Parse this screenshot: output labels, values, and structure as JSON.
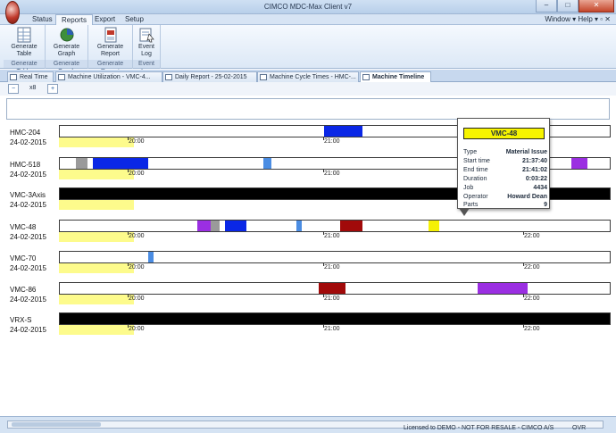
{
  "window": {
    "title": "CIMCO MDC-Max Client v7",
    "buttons": {
      "minimize": "–",
      "maximize": "□",
      "close": "✕"
    }
  },
  "menu": {
    "tabs": [
      "Status",
      "Reports",
      "Export",
      "Setup"
    ],
    "active_index": 1,
    "right": "Window ▾  Help ▾  ▫ ✕"
  },
  "ribbon": {
    "groups": [
      {
        "label": "Generate Table",
        "button": "Generate\nTable",
        "icon": "table-icon"
      },
      {
        "label": "Generate Graph",
        "button": "Generate\nGraph",
        "icon": "graph-icon"
      },
      {
        "label": "Generate Report",
        "button": "Generate\nReport",
        "icon": "report-icon"
      },
      {
        "label": "Event Log",
        "button": "Event\nLog",
        "icon": "event-log-icon"
      }
    ]
  },
  "doc_tabs": [
    "Real Time",
    "Machine Utilization - VMC-4...",
    "Daily Report - 25-02-2015",
    "Machine Cycle Times - HMC-...",
    "Machine Timeline"
  ],
  "toolbar": {
    "zoom_out_icon": "zoom-out-icon",
    "zoom_value": "x8",
    "zoom_in_icon": "zoom-in-icon"
  },
  "colors": {
    "running": "#138a13",
    "stopped": "#e4110e",
    "blue": "#0a27e6",
    "purple": "#9b2fe2",
    "maroon": "#a10a0a",
    "gray": "#9a9a9a",
    "light_blue": "#4b8de3",
    "yellow": "#f5f105",
    "offline": "#000000"
  },
  "machines": [
    {
      "name": "HMC-204",
      "date": "24-02-2015",
      "ticks": [
        "20:00",
        "21:00"
      ],
      "segments": [
        [
          "red",
          0,
          1.2
        ],
        [
          "green",
          1.2,
          4
        ],
        [
          "red",
          4,
          4.8
        ],
        [
          "green",
          4.8,
          8
        ],
        [
          "red",
          8,
          9
        ],
        [
          "green",
          9,
          14
        ],
        [
          "red",
          14,
          15
        ],
        [
          "green",
          15,
          19
        ],
        [
          "red",
          19,
          20.5
        ],
        [
          "green",
          20.5,
          26
        ],
        [
          "red",
          26,
          27
        ],
        [
          "green",
          27,
          30
        ],
        [
          "red",
          30,
          31
        ],
        [
          "green",
          31,
          35
        ],
        [
          "red",
          35,
          36
        ],
        [
          "green",
          36,
          40
        ],
        [
          "red",
          40,
          41.5
        ],
        [
          "green",
          41.5,
          44
        ],
        [
          "red",
          44,
          45
        ],
        [
          "green",
          45,
          48
        ],
        [
          "blue",
          48,
          55
        ],
        [
          "red",
          55,
          57
        ],
        [
          "green",
          57,
          60
        ],
        [
          "red",
          60,
          61
        ],
        [
          "green",
          61,
          63
        ],
        [
          "red",
          63,
          64
        ],
        [
          "green",
          64,
          67
        ],
        [
          "red",
          67,
          68
        ],
        [
          "green",
          68,
          71
        ],
        [
          "red",
          71,
          72.5
        ],
        [
          "green",
          72.5,
          76
        ],
        [
          "red",
          76,
          77
        ],
        [
          "green",
          77,
          80
        ],
        [
          "red",
          80,
          81
        ],
        [
          "green",
          81,
          86
        ],
        [
          "red",
          86,
          87
        ],
        [
          "green",
          87,
          90
        ],
        [
          "red",
          90,
          91
        ],
        [
          "green",
          91,
          94
        ],
        [
          "red",
          94,
          95
        ],
        [
          "green",
          95,
          100
        ]
      ]
    },
    {
      "name": "HMC-518",
      "date": "24-02-2015",
      "ticks": [
        "20:00",
        "21:00"
      ],
      "segments": [
        [
          "green",
          0,
          2
        ],
        [
          "red",
          2,
          3
        ],
        [
          "gray",
          3,
          5
        ],
        [
          "red",
          5,
          6
        ],
        [
          "blue",
          6,
          16
        ],
        [
          "green",
          16,
          19
        ],
        [
          "red",
          19,
          20
        ],
        [
          "green",
          20,
          24
        ],
        [
          "red",
          24,
          25
        ],
        [
          "green",
          25,
          37
        ],
        [
          "light_blue",
          37,
          38.5
        ],
        [
          "red",
          38.5,
          39.5
        ],
        [
          "green",
          39.5,
          43
        ],
        [
          "red",
          43,
          44
        ],
        [
          "green",
          44,
          47
        ],
        [
          "red",
          47,
          48
        ],
        [
          "green",
          48,
          52
        ],
        [
          "red",
          52,
          53
        ],
        [
          "green",
          53,
          58
        ],
        [
          "red",
          58,
          59
        ],
        [
          "green",
          59,
          63
        ],
        [
          "red",
          63,
          64
        ],
        [
          "green",
          64,
          68
        ],
        [
          "red",
          68,
          69
        ],
        [
          "green",
          69,
          73
        ],
        [
          "red",
          73,
          74
        ],
        [
          "green",
          74,
          78
        ],
        [
          "red",
          78,
          79
        ],
        [
          "green",
          79,
          84
        ],
        [
          "red",
          84,
          85
        ],
        [
          "green",
          85,
          89
        ],
        [
          "red",
          89,
          90
        ],
        [
          "green",
          90,
          93
        ],
        [
          "purple",
          93,
          96
        ],
        [
          "red",
          96,
          97
        ],
        [
          "green",
          97,
          100
        ]
      ]
    },
    {
      "name": "VMC-3Axis",
      "date": "24-02-2015",
      "ticks": [],
      "segments": [
        [
          "offline",
          0,
          100
        ]
      ]
    },
    {
      "name": "VMC-48",
      "date": "24-02-2015",
      "ticks": [
        "20:00",
        "21:00",
        "22:00"
      ],
      "segments": [
        [
          "green",
          0,
          12
        ],
        [
          "red",
          12,
          13
        ],
        [
          "green",
          13,
          25
        ],
        [
          "purple",
          25,
          27.5
        ],
        [
          "gray",
          27.5,
          29
        ],
        [
          "red",
          29,
          30
        ],
        [
          "blue",
          30,
          34
        ],
        [
          "red",
          34,
          35
        ],
        [
          "green",
          35,
          43
        ],
        [
          "light_blue",
          43,
          44
        ],
        [
          "green",
          44,
          51
        ],
        [
          "maroon",
          51,
          55
        ],
        [
          "green",
          55,
          63
        ],
        [
          "red",
          63,
          64
        ],
        [
          "green",
          64,
          67
        ],
        [
          "yellow",
          67,
          69
        ],
        [
          "green",
          69,
          74
        ],
        [
          "red",
          74,
          75
        ],
        [
          "green",
          75,
          81
        ],
        [
          "red",
          81,
          82
        ],
        [
          "green",
          82,
          88
        ],
        [
          "red",
          88,
          89
        ],
        [
          "green",
          89,
          95
        ],
        [
          "red",
          95,
          96
        ],
        [
          "green",
          96,
          100
        ]
      ]
    },
    {
      "name": "VMC-70",
      "date": "24-02-2015",
      "ticks": [
        "20:00",
        "21:00",
        "22:00"
      ],
      "segments": [
        [
          "red",
          0,
          1
        ],
        [
          "green",
          1,
          6
        ],
        [
          "red",
          6,
          7
        ],
        [
          "green",
          7,
          11
        ],
        [
          "red",
          11,
          12
        ],
        [
          "green",
          12,
          15
        ],
        [
          "red",
          15,
          16
        ],
        [
          "light_blue",
          16,
          17
        ],
        [
          "red",
          17,
          18
        ],
        [
          "green",
          18,
          24
        ],
        [
          "red",
          24,
          25
        ],
        [
          "green",
          25,
          34
        ],
        [
          "red",
          34,
          36
        ],
        [
          "green",
          36,
          41
        ],
        [
          "red",
          41,
          42
        ],
        [
          "green",
          42,
          47
        ],
        [
          "red",
          47,
          48
        ],
        [
          "green",
          48,
          53
        ],
        [
          "red",
          53,
          54
        ],
        [
          "green",
          54,
          60
        ],
        [
          "red",
          60,
          61
        ],
        [
          "green",
          61,
          67
        ],
        [
          "red",
          67,
          68
        ],
        [
          "green",
          68,
          74
        ],
        [
          "red",
          74,
          75
        ],
        [
          "green",
          75,
          80
        ],
        [
          "red",
          80,
          81
        ],
        [
          "green",
          81,
          87
        ],
        [
          "red",
          87,
          88
        ],
        [
          "green",
          88,
          93
        ],
        [
          "red",
          93,
          94
        ],
        [
          "green",
          94,
          100
        ]
      ]
    },
    {
      "name": "VMC-86",
      "date": "24-02-2015",
      "ticks": [
        "20:00",
        "21:00",
        "22:00"
      ],
      "segments": [
        [
          "green",
          0,
          2
        ],
        [
          "red",
          2,
          3
        ],
        [
          "green",
          3,
          6
        ],
        [
          "red",
          6,
          7.5
        ],
        [
          "green",
          7.5,
          11
        ],
        [
          "red",
          11,
          12
        ],
        [
          "green",
          12,
          14
        ],
        [
          "red",
          14,
          15
        ],
        [
          "green",
          15,
          19
        ],
        [
          "red",
          19,
          20
        ],
        [
          "green",
          20,
          24
        ],
        [
          "red",
          24,
          25
        ],
        [
          "green",
          25,
          30
        ],
        [
          "red",
          30,
          31
        ],
        [
          "green",
          31,
          35
        ],
        [
          "red",
          35,
          36
        ],
        [
          "green",
          36,
          42
        ],
        [
          "red",
          42,
          43
        ],
        [
          "green",
          43,
          47
        ],
        [
          "maroon",
          47,
          52
        ],
        [
          "green",
          52,
          56
        ],
        [
          "red",
          56,
          57
        ],
        [
          "green",
          57,
          62
        ],
        [
          "red",
          62,
          63
        ],
        [
          "green",
          63,
          67
        ],
        [
          "red",
          67,
          68
        ],
        [
          "green",
          68,
          76
        ],
        [
          "purple",
          76,
          85
        ],
        [
          "red",
          85,
          86
        ],
        [
          "green",
          86,
          90
        ],
        [
          "red",
          90,
          91
        ],
        [
          "green",
          91,
          96
        ],
        [
          "red",
          96,
          97
        ],
        [
          "green",
          97,
          100
        ]
      ]
    },
    {
      "name": "VRX-S",
      "date": "24-02-2015",
      "ticks": [
        "20:00",
        "21:00",
        "22:00"
      ],
      "segments": [
        [
          "offline",
          0,
          100
        ]
      ]
    }
  ],
  "tooltip": {
    "title": "VMC-48",
    "rows": [
      {
        "key": "Type",
        "value": "Material Issue"
      },
      {
        "key": "Start time",
        "value": "21:37:40"
      },
      {
        "key": "End time",
        "value": "21:41:02"
      },
      {
        "key": "Duration",
        "value": "0:03:22"
      },
      {
        "key": "Job",
        "value": "4434"
      },
      {
        "key": "Operator",
        "value": "Howard Dean"
      },
      {
        "key": "Parts",
        "value": "9"
      }
    ]
  },
  "status": {
    "license": "Licensed to DEMO - NOT FOR RESALE - CIMCO A/S",
    "mode": "OVR"
  }
}
